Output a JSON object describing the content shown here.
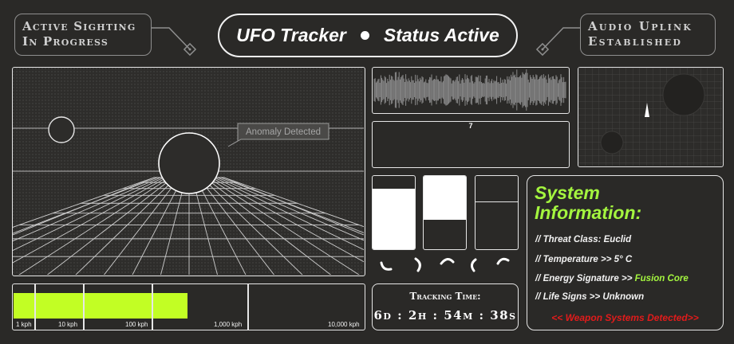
{
  "header": {
    "left_tag": [
      "Active Sighting",
      "In Progress"
    ],
    "title_left": "UFO Tracker",
    "title_right": "Status Active",
    "right_tag": [
      "Audio Uplink",
      "Established"
    ]
  },
  "main_view": {
    "anomaly_label": "Anomaly Detected"
  },
  "speed_bar": {
    "labels": [
      "1 kph",
      "10 kph",
      "100 kph",
      "1,000 kph",
      "10,000 kph"
    ],
    "fill_fraction": 0.495,
    "fill_color": "#c2fe24"
  },
  "signal_panel": {
    "value": "7"
  },
  "tracking": {
    "label": "Tracking Time:",
    "value": "6d : 2h : 54m : 38s"
  },
  "system_info": {
    "title_line1": "System",
    "title_line2": "Information:",
    "title_color": "#a4f53f",
    "threat_class": "// Threat Class: Euclid",
    "temperature": "// Temperature >> 5° C",
    "energy_prefix": "// Energy Signature >> ",
    "energy_value": "Fusion Core",
    "energy_color": "#a4f53f",
    "life_signs": "// Life Signs >> Unknown",
    "warning": "<< Weapon Systems Detected>>",
    "warning_color": "#e11b1b"
  },
  "level_meters": [
    0.83,
    0.6,
    0.36
  ],
  "icons": [
    "connector-icon",
    "arc-glyph-icon"
  ]
}
